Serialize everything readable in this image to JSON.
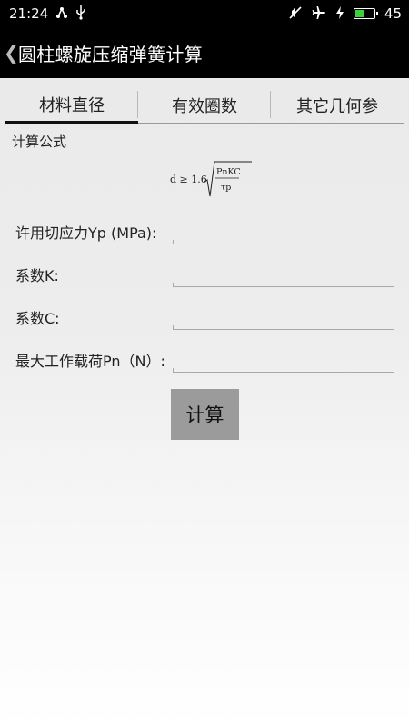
{
  "status_bar": {
    "time": "21:24",
    "battery_level": "45",
    "battery_fraction": 0.45,
    "icons_left": [
      "share-icon",
      "usb-icon"
    ],
    "icons_right": [
      "mute-icon",
      "airplane-icon",
      "charging-icon",
      "battery-icon"
    ]
  },
  "header": {
    "back_glyph": "❮",
    "title": "圆柱螺旋压缩弹簧计算"
  },
  "tabs": [
    {
      "label": "材料直径",
      "active": true
    },
    {
      "label": "有效圈数",
      "active": false
    },
    {
      "label": "其它几何参",
      "active": false
    }
  ],
  "main": {
    "section_label": "计算公式",
    "formula": {
      "lhs": "d ≥ 1.6",
      "numerator": "PnKC",
      "denominator": "τp"
    },
    "fields": [
      {
        "label": "许用切应力Yp (MPa):",
        "value": ""
      },
      {
        "label": "系数K:",
        "value": ""
      },
      {
        "label": "系数C:",
        "value": ""
      },
      {
        "label": "最大工作载荷Pn（N）:",
        "value": ""
      }
    ],
    "calc_button": "计算"
  },
  "colors": {
    "bar_bg": "#000000",
    "button_bg": "#9b9b9b",
    "battery_green": "#3cd23c"
  }
}
